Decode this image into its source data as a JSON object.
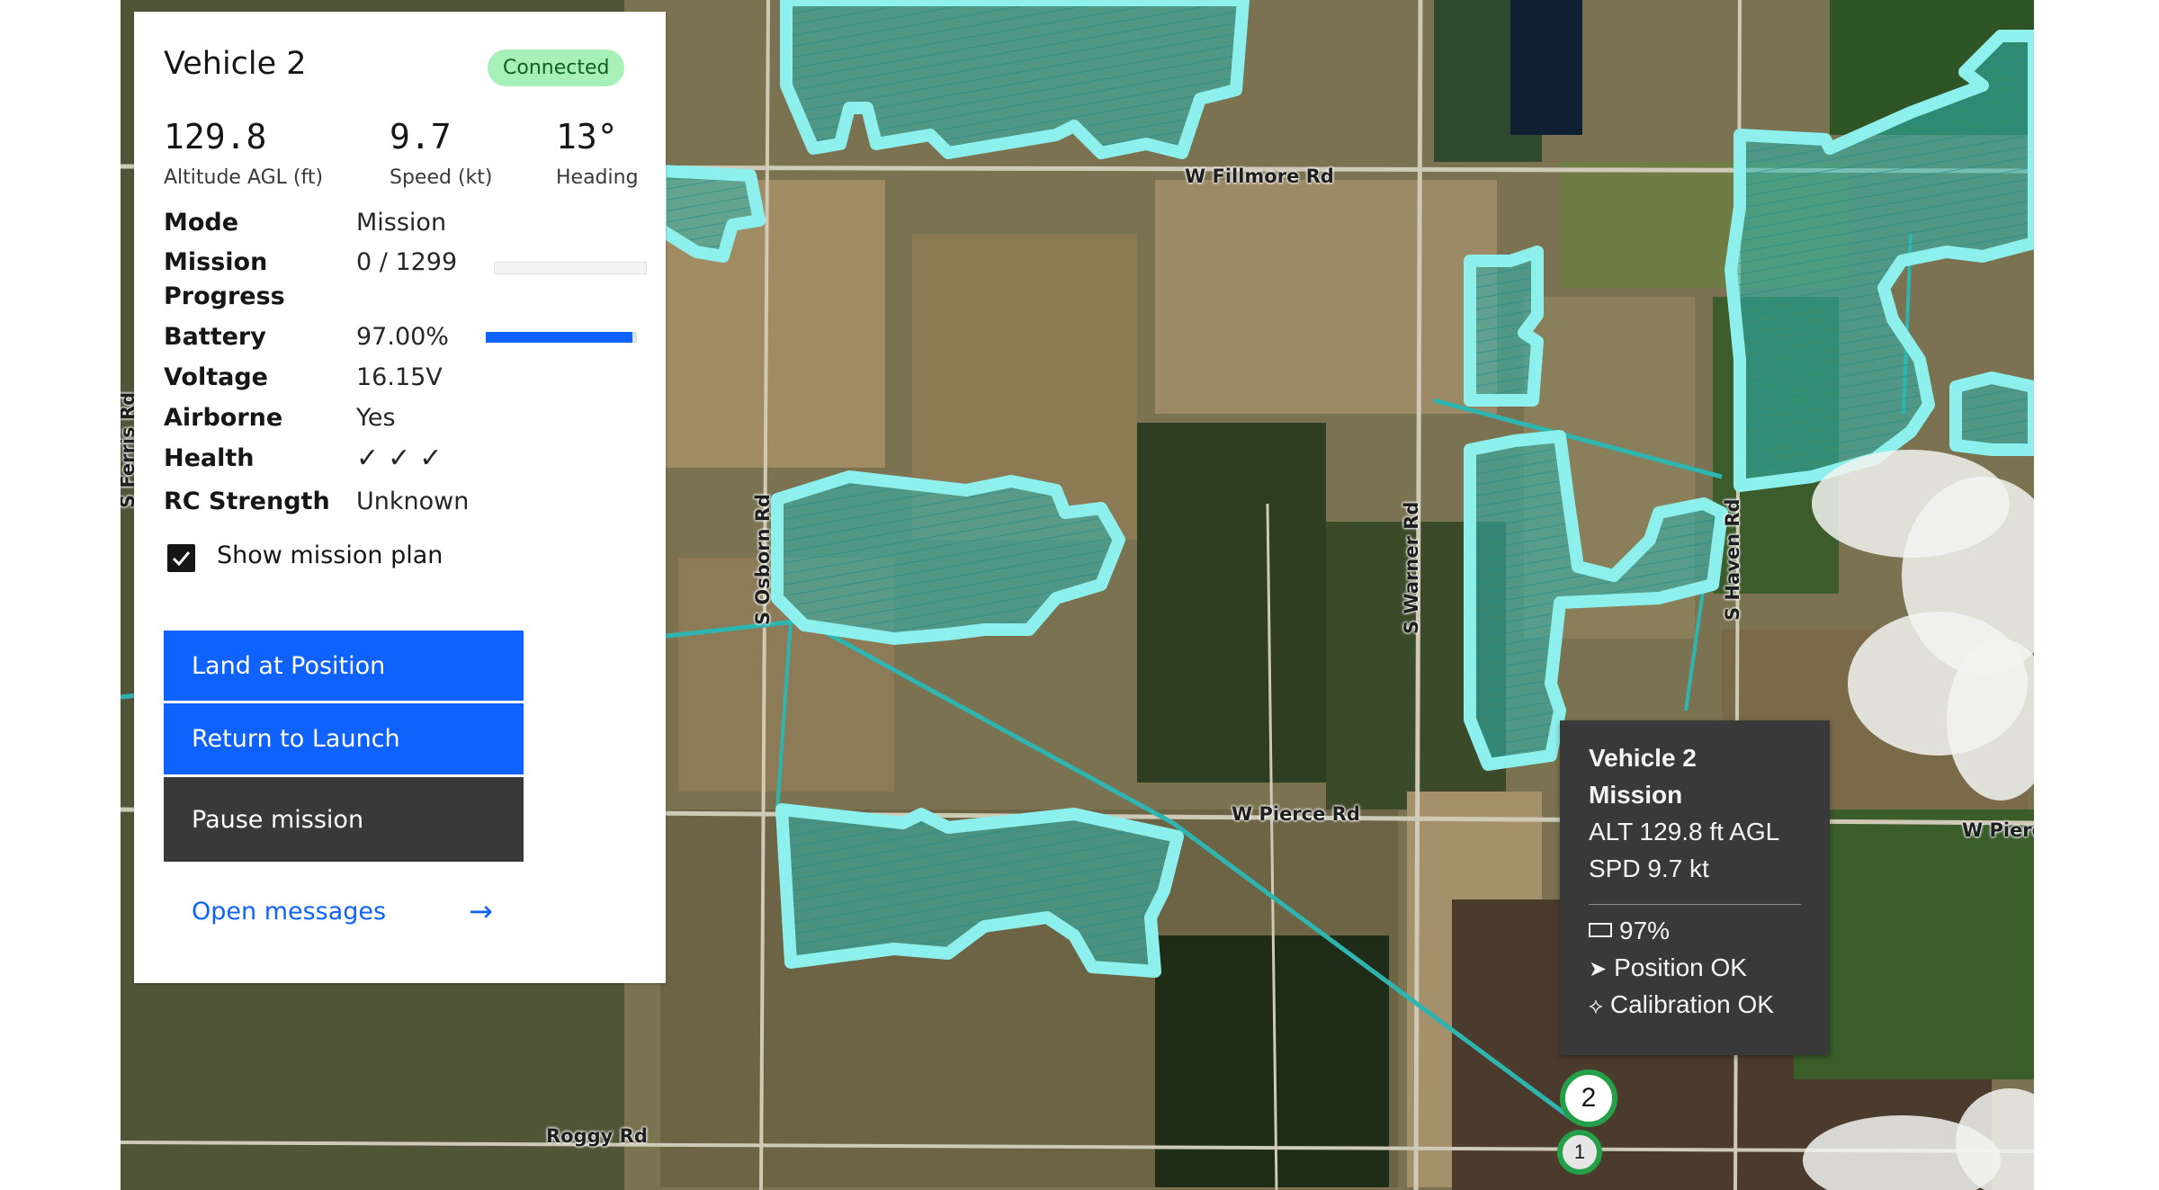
{
  "vehicle_panel": {
    "title": "Vehicle 2",
    "status_badge": "Connected",
    "stats": [
      {
        "value": "129.8",
        "label": "Altitude AGL (ft)"
      },
      {
        "value": "9.7",
        "label": "Speed (kt)"
      },
      {
        "value": "13°",
        "label": "Heading"
      }
    ],
    "rows": {
      "mode": {
        "label": "Mode",
        "value": "Mission"
      },
      "mission_progress": {
        "label": "Mission Progress",
        "value": "0 / 1299",
        "fraction": 0.0
      },
      "battery": {
        "label": "Battery",
        "value": "97.00%",
        "fraction": 0.97
      },
      "voltage": {
        "label": "Voltage",
        "value": "16.15V"
      },
      "airborne": {
        "label": "Airborne",
        "value": "Yes"
      },
      "health": {
        "label": "Health",
        "value": "✓✓✓"
      },
      "rc_strength": {
        "label": "RC Strength",
        "value": "Unknown"
      }
    },
    "show_mission_plan": {
      "label": "Show mission plan",
      "checked": true
    },
    "buttons": {
      "land": "Land at Position",
      "rtl": "Return to Launch",
      "pause": "Pause mission"
    },
    "open_messages": "Open messages"
  },
  "map": {
    "road_labels": [
      "W Fillmore Rd",
      "W Pierce Rd",
      "W Pierce",
      "Roggy Rd",
      "S Osborn Rd",
      "S Warner Rd",
      "S Haven Rd",
      "S Ferris Rd"
    ],
    "markers": [
      "2",
      "1"
    ]
  },
  "tooltip": {
    "name": "Vehicle 2",
    "mode": "Mission",
    "altitude": "ALT 129.8 ft AGL",
    "speed": "SPD 9.7 kt",
    "battery": "97%",
    "position": "Position OK",
    "calibration": "Calibration OK"
  },
  "colors": {
    "accent_blue": "#0f62fe",
    "polygon_fill": "#2fb5b0",
    "polygon_stroke": "#8ef0ec",
    "badge_bg": "#a7f0ba",
    "marker_ring": "#24a148"
  }
}
